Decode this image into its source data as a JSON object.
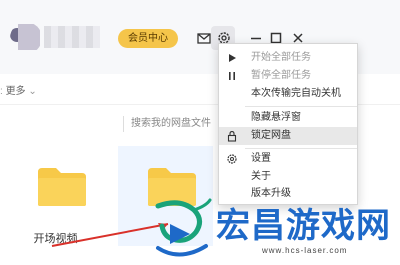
{
  "header": {
    "vip_label": "会员中心"
  },
  "toolbar": {
    "more_label": "更多",
    "search_placeholder": "搜索我的网盘文件"
  },
  "files": [
    {
      "name": "开场视频"
    },
    {
      "name": ""
    }
  ],
  "context_menu": {
    "items": [
      {
        "label": "开始全部任务",
        "disabled": true,
        "icon": "play-icon"
      },
      {
        "label": "暂停全部任务",
        "disabled": true,
        "icon": "pause-icon"
      },
      {
        "label": "本次传输完自动关机",
        "disabled": false,
        "icon": ""
      },
      {
        "label": "隐藏悬浮窗",
        "disabled": false,
        "icon": ""
      },
      {
        "label": "锁定网盘",
        "disabled": false,
        "icon": "lock-icon"
      },
      {
        "label": "设置",
        "disabled": false,
        "icon": "gear-icon"
      },
      {
        "label": "关于",
        "disabled": false,
        "icon": ""
      },
      {
        "label": "版本升级",
        "disabled": false,
        "icon": ""
      }
    ]
  },
  "watermark": {
    "title": "宏昌游戏网",
    "url": "www.hcs-laser.com"
  },
  "colors": {
    "accent_vip": "#f5c54a",
    "folder_yellow": "#f7c948",
    "arrow_red": "#d9312a",
    "watermark_blue": "#1e69c8",
    "watermark_green": "#1aa37a"
  }
}
